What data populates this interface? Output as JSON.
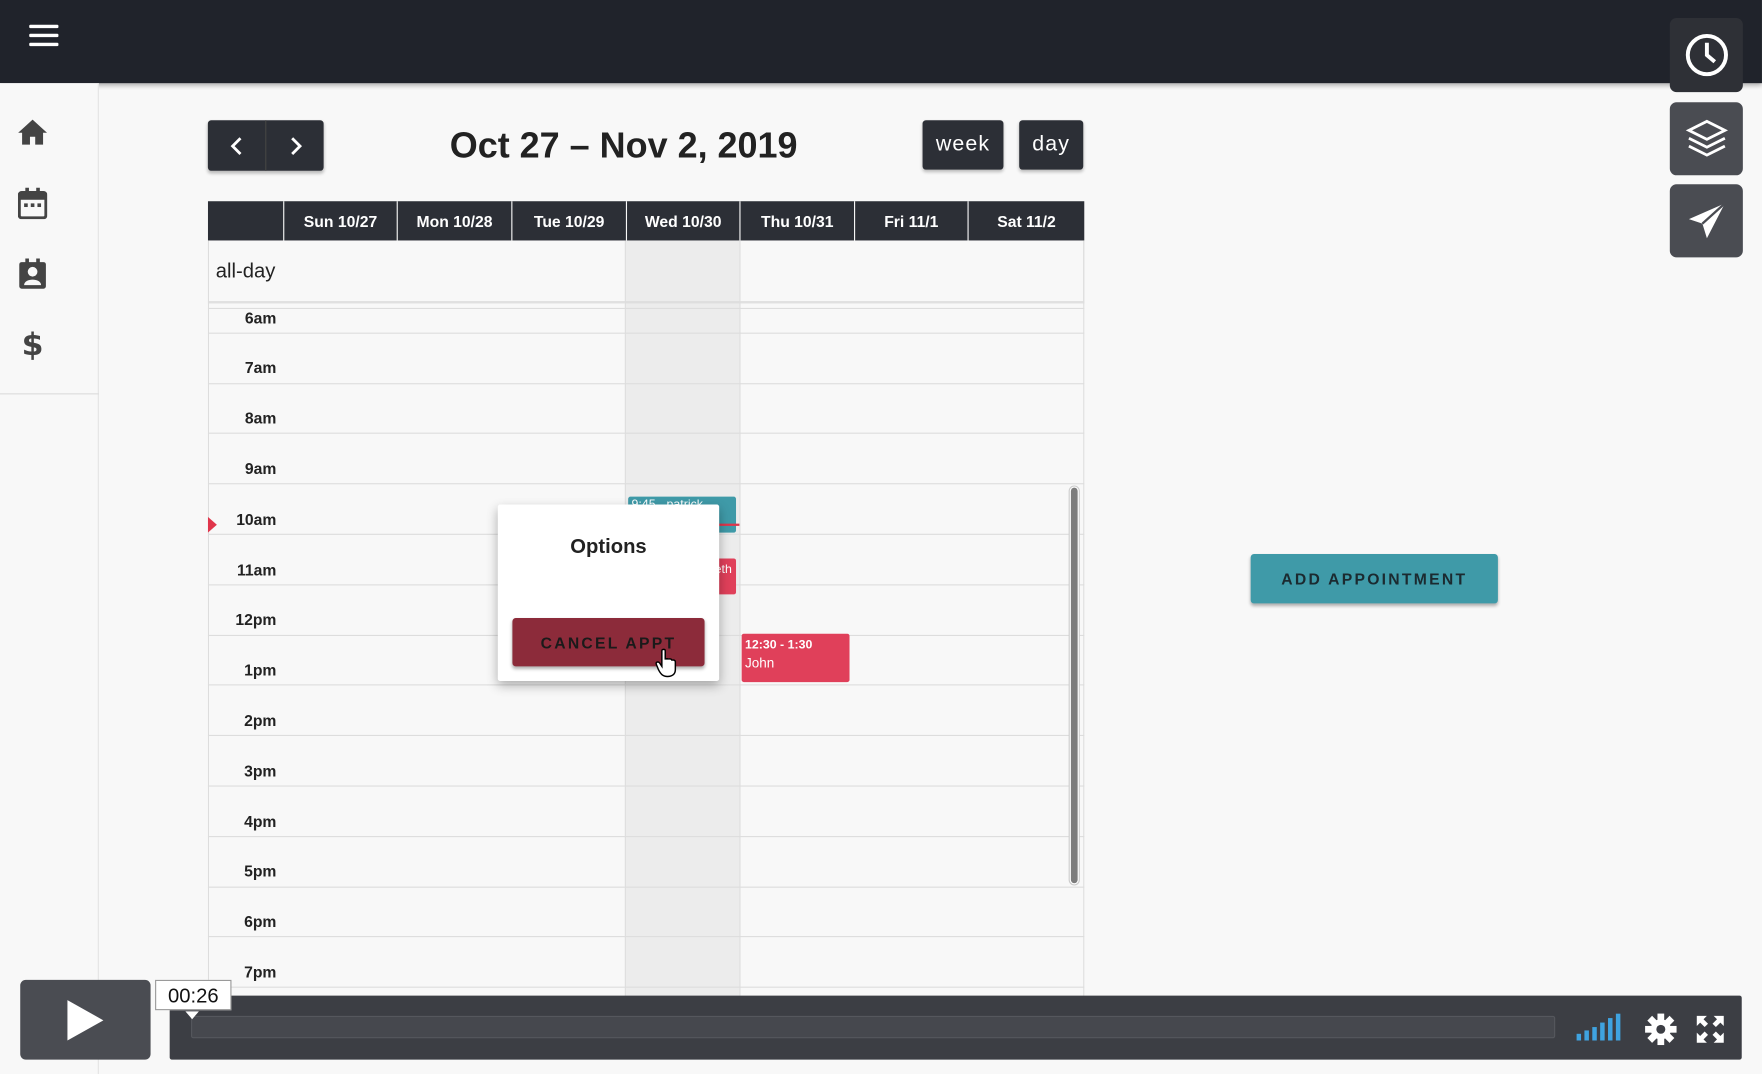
{
  "header": {
    "menu_icon": "hamburger-menu-icon"
  },
  "sidebar": {
    "items": [
      {
        "name": "home",
        "icon": "home-icon"
      },
      {
        "name": "calendar",
        "icon": "calendar-icon"
      },
      {
        "name": "contacts",
        "icon": "contact-card-icon"
      },
      {
        "name": "billing",
        "icon": "dollar-icon"
      }
    ]
  },
  "calendar": {
    "title": "Oct 27 – Nov 2, 2019",
    "views": {
      "week": "week",
      "day": "day"
    },
    "days": [
      "Sun 10/27",
      "Mon 10/28",
      "Tue 10/29",
      "Wed 10/30",
      "Thu 10/31",
      "Fri 11/1",
      "Sat 11/2"
    ],
    "allday_label": "all-day",
    "times": [
      "6am",
      "7am",
      "8am",
      "9am",
      "10am",
      "11am",
      "12pm",
      "1pm",
      "2pm",
      "3pm",
      "4pm",
      "5pm",
      "6pm",
      "7pm"
    ],
    "events": [
      {
        "day": "Wed 10/30",
        "time": "9:45",
        "label": "9:45 - patrick",
        "color": "#3f9aa8"
      },
      {
        "day": "Wed 10/30",
        "time": "",
        "label": "eth",
        "color": "#e0405a"
      },
      {
        "day": "Thu 10/31",
        "time": "12:30 - 1:30",
        "label": "John",
        "color": "#e0405a"
      }
    ]
  },
  "modal": {
    "title": "Options",
    "cancel_label": "CANCEL APPT"
  },
  "actions": {
    "add_appointment": "ADD APPOINTMENT"
  },
  "tools": [
    "clock-icon",
    "layers-icon",
    "send-icon"
  ],
  "player": {
    "time": "00:26",
    "play_icon": "play-icon",
    "volume_icon": "volume-bars-icon",
    "settings_icon": "gear-icon",
    "fullscreen_icon": "fullscreen-icon"
  },
  "colors": {
    "accent_teal": "#3f9aa8",
    "danger_red": "#e0405a",
    "dark": "#2c2f36"
  }
}
